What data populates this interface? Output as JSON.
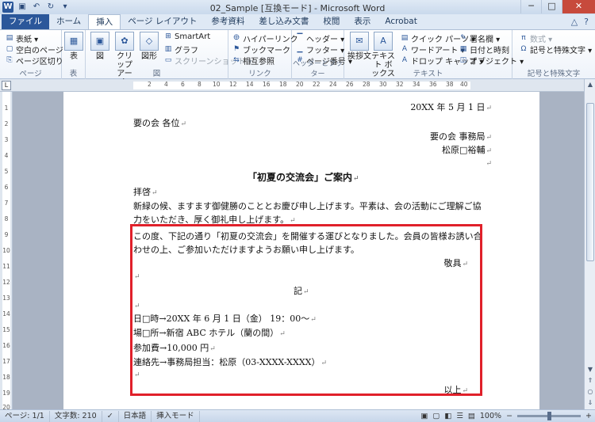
{
  "window": {
    "title": "02_Sample [互換モード] - Microsoft Word",
    "minimize": "─",
    "restore": "□",
    "close": "✕"
  },
  "qat": {
    "logo": "W",
    "save": "▣",
    "undo": "↶",
    "redo": "↻",
    "customize": "▾"
  },
  "tabs": [
    "ファイル",
    "ホーム",
    "挿入",
    "ページ レイアウト",
    "参考資料",
    "差し込み文書",
    "校閲",
    "表示",
    "Acrobat"
  ],
  "active_tab": "挿入",
  "tabs_right": {
    "collapse": "△",
    "help": "?"
  },
  "ribbon": {
    "page": {
      "label": "ページ",
      "cover": "表紙 ▾",
      "blank": "空白のページ",
      "break": "ページ区切り"
    },
    "table": {
      "label": "表",
      "table_btn": "表"
    },
    "illustrations": {
      "label": "図",
      "picture": "図",
      "clipart": "クリップ アート",
      "shapes": "図形",
      "smartart": "SmartArt",
      "chart": "グラフ",
      "screenshot": "スクリーンショット ▾"
    },
    "links": {
      "label": "リンク",
      "hyperlink": "ハイパーリンク",
      "bookmark": "ブックマーク",
      "crossref": "相互参照"
    },
    "header_footer": {
      "label": "ヘッダーとフッター",
      "header": "ヘッダー ▾",
      "footer": "フッター ▾",
      "page_number": "ページ番号 ▾"
    },
    "text": {
      "label": "テキスト",
      "greeting": "挨拶文",
      "textbox": "テキスト ボックス",
      "quickparts": "クイック パーツ ▾",
      "wordart": "ワードアート ▾",
      "dropcap": "ドロップ キャップ ▾",
      "signature": "署名欄 ▾",
      "datetime": "日付と時刻",
      "object": "オブジェクト ▾"
    },
    "symbols": {
      "label": "記号と特殊文字",
      "equation": "数式 ▾",
      "symbol": "記号と特殊文字 ▾"
    }
  },
  "ruler_marks": [
    "2",
    "4",
    "6",
    "8",
    "10",
    "12",
    "14",
    "16",
    "18",
    "20",
    "22",
    "24",
    "26",
    "28",
    "30",
    "32",
    "34",
    "36",
    "38",
    "40"
  ],
  "vruler_marks": [
    "1",
    "2",
    "3",
    "4",
    "5",
    "6",
    "7",
    "8",
    "9",
    "10",
    "11",
    "12",
    "13",
    "14",
    "15",
    "16",
    "17",
    "18",
    "19",
    "20"
  ],
  "document": {
    "date": "20XX 年 5 月 1 日",
    "to": "要の会 各位",
    "from_org": "要の会 事務局",
    "from_name": "松原□裕輔",
    "title": "「初夏の交流会」ご案内",
    "greeting": "拝啓",
    "body1a": "新緑の候、ますます御健勝のこととお慶び申し上げます。平素は、会の活動にご理解ご協",
    "body1b": "力をいただき、厚く御礼申し上げます。",
    "body2a": "この度、下記の通り「初夏の交流会」を開催する運びとなりました。会員の皆様お誘い合",
    "body2b": "わせの上、ご参加いただけますようお願い申し上げます。",
    "closing": "敬具",
    "ki": "記",
    "item_date": "日□時→20XX 年 6 月 1 日（金） 19：00～",
    "item_place": "場□所→新宿 ABC ホテル（蘭の間）",
    "item_fee": "参加費→10,000 円",
    "item_contact": "連絡先→事務局担当：松原（03-XXXX-XXXX）",
    "end": "以上",
    "return_mark": "↵"
  },
  "status": {
    "page": "ページ: 1/1",
    "words": "文字数: 210",
    "proof": "✓",
    "language": "日本語",
    "mode": "挿入モード",
    "zoom": "100%",
    "zoom_out": "−",
    "zoom_in": "+"
  }
}
